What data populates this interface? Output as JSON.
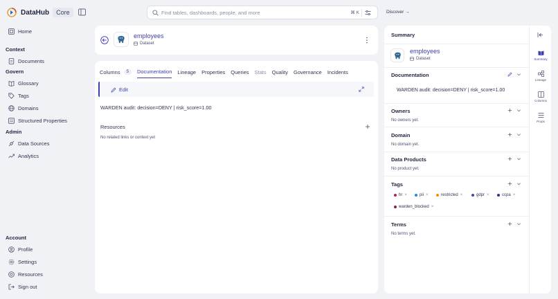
{
  "app": {
    "name": "DataHub",
    "badge": "Core"
  },
  "nav": {
    "home": "Home",
    "sections": {
      "context": "Context",
      "govern": "Govern",
      "admin": "Admin",
      "account": "Account"
    },
    "documents": "Documents",
    "glossary": "Glossary",
    "tags": "Tags",
    "domains": "Domains",
    "structured_properties": "Structured Properties",
    "data_sources": "Data Sources",
    "analytics": "Analytics",
    "profile": "Profile",
    "settings": "Settings",
    "resources": "Resources",
    "sign_out": "Sign out"
  },
  "search": {
    "placeholder": "Find tables, dashboards, people, and more",
    "shortcut": "⌘ K"
  },
  "discover": {
    "label": "Discover →"
  },
  "entity": {
    "name": "employees",
    "type": "Dataset"
  },
  "tabs": [
    {
      "label": "Columns",
      "count": "5"
    },
    {
      "label": "Documentation"
    },
    {
      "label": "Lineage"
    },
    {
      "label": "Properties"
    },
    {
      "label": "Queries"
    },
    {
      "label": "Stats"
    },
    {
      "label": "Quality"
    },
    {
      "label": "Governance"
    },
    {
      "label": "Incidents"
    }
  ],
  "documentation": {
    "edit_label": "Edit",
    "text": "WARDEN audit: decision=DENY | risk_score=1.00"
  },
  "resources": {
    "title": "Resources",
    "empty": "No related links or context yet"
  },
  "summary": {
    "title": "Summary",
    "documentation_title": "Documentation",
    "documentation_text": "WARDEN audit: decision=DENY | risk_score=1.00",
    "owners_title": "Owners",
    "owners_empty": "No owners yet.",
    "domain_title": "Domain",
    "domain_empty": "No domain yet.",
    "data_products_title": "Data Products",
    "data_products_empty": "No product yet.",
    "tags_title": "Tags",
    "tags": [
      {
        "label": "hr",
        "color": "#c2185b"
      },
      {
        "label": "pii",
        "color": "#1e88e5"
      },
      {
        "label": "restricted",
        "color": "#fb8c00"
      },
      {
        "label": "gdpr",
        "color": "#3949ab"
      },
      {
        "label": "ccpa",
        "color": "#283593"
      },
      {
        "label": "warden_blocked",
        "color": "#8e1b4f"
      }
    ],
    "terms_title": "Terms",
    "terms_empty": "No terms yet."
  },
  "rail": {
    "summary": "Summary",
    "lineage": "Lineage",
    "columns": "Columns",
    "props": "Props"
  },
  "colors": {
    "accent": "#3c3fae",
    "background": "#f1f2f5"
  }
}
